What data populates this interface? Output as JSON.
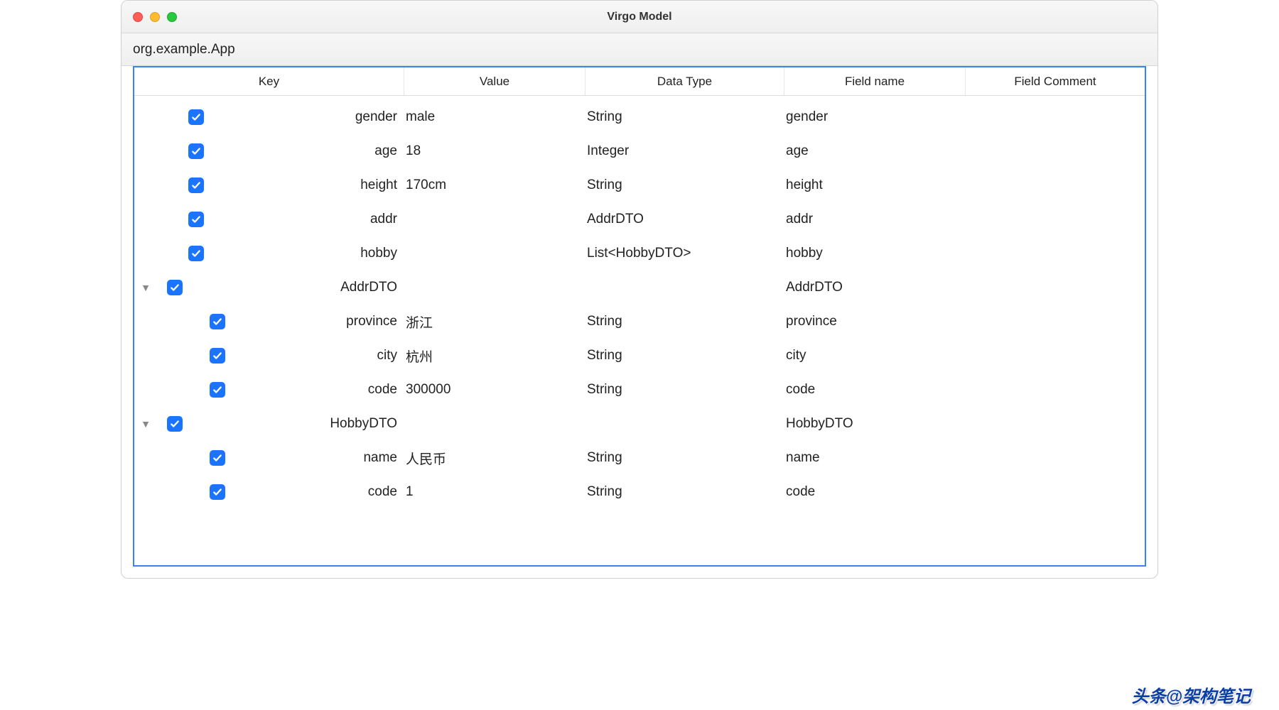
{
  "window": {
    "title": "Virgo Model"
  },
  "breadcrumb": {
    "path": "org.example.App"
  },
  "columns": {
    "key": "Key",
    "value": "Value",
    "type": "Data Type",
    "field": "Field name",
    "comment": "Field Comment"
  },
  "rows": [
    {
      "indent": 1,
      "expandable": false,
      "checked": true,
      "key": "gender",
      "value": "male",
      "type": "String",
      "field": "gender",
      "comment": ""
    },
    {
      "indent": 1,
      "expandable": false,
      "checked": true,
      "key": "age",
      "value": "18",
      "type": "Integer",
      "field": "age",
      "comment": ""
    },
    {
      "indent": 1,
      "expandable": false,
      "checked": true,
      "key": "height",
      "value": "170cm",
      "type": "String",
      "field": "height",
      "comment": ""
    },
    {
      "indent": 1,
      "expandable": false,
      "checked": true,
      "key": "addr",
      "value": "",
      "type": "AddrDTO",
      "field": "addr",
      "comment": ""
    },
    {
      "indent": 1,
      "expandable": false,
      "checked": true,
      "key": "hobby",
      "value": "",
      "type": "List<HobbyDTO>",
      "field": "hobby",
      "comment": ""
    },
    {
      "indent": 0,
      "expandable": true,
      "checked": true,
      "key": "AddrDTO",
      "value": "",
      "type": "",
      "field": "AddrDTO",
      "comment": ""
    },
    {
      "indent": 2,
      "expandable": false,
      "checked": true,
      "key": "province",
      "value": "浙江",
      "type": "String",
      "field": "province",
      "comment": ""
    },
    {
      "indent": 2,
      "expandable": false,
      "checked": true,
      "key": "city",
      "value": "杭州",
      "type": "String",
      "field": "city",
      "comment": ""
    },
    {
      "indent": 2,
      "expandable": false,
      "checked": true,
      "key": "code",
      "value": "300000",
      "type": "String",
      "field": "code",
      "comment": ""
    },
    {
      "indent": 0,
      "expandable": true,
      "checked": true,
      "key": "HobbyDTO",
      "value": "",
      "type": "",
      "field": "HobbyDTO",
      "comment": ""
    },
    {
      "indent": 2,
      "expandable": false,
      "checked": true,
      "key": "name",
      "value": "人民币",
      "type": "String",
      "field": "name",
      "comment": ""
    },
    {
      "indent": 2,
      "expandable": false,
      "checked": true,
      "key": "code",
      "value": "1",
      "type": "String",
      "field": "code",
      "comment": ""
    }
  ],
  "watermark": {
    "text": "头条@架构笔记"
  }
}
